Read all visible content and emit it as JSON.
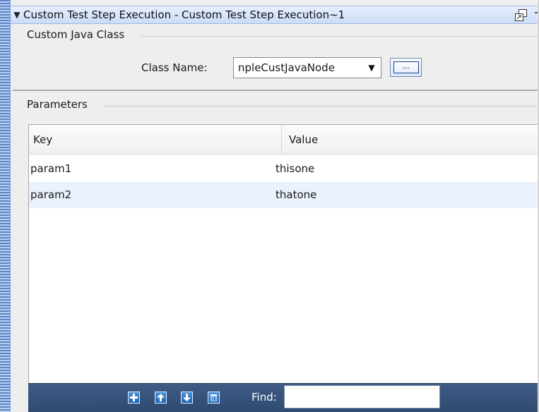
{
  "panel": {
    "title": "Custom Test Step Execution - Custom Test Step Execution~1",
    "collapse_icon": "triangle-down",
    "restore_icon": "restore-window"
  },
  "java_class": {
    "section_label": "Custom Java Class",
    "class_name_label": "Class Name:",
    "class_name_value": "npleCustJavaNode",
    "dropdown_icon": "triangle-down",
    "browse_label": "..."
  },
  "parameters": {
    "section_label": "Parameters",
    "columns": [
      "Key",
      "Value"
    ],
    "rows": [
      {
        "key": "param1",
        "value": "thisone"
      },
      {
        "key": "param2",
        "value": "thatone"
      }
    ]
  },
  "toolbar": {
    "buttons": [
      "add-icon",
      "move-up-icon",
      "move-down-icon",
      "delete-icon"
    ],
    "find_label": "Find:",
    "find_value": ""
  },
  "colors": {
    "title_bar": "#ccdcf6",
    "footer_bar": "#3f5c86",
    "selected_row": "#eaf2fd"
  }
}
